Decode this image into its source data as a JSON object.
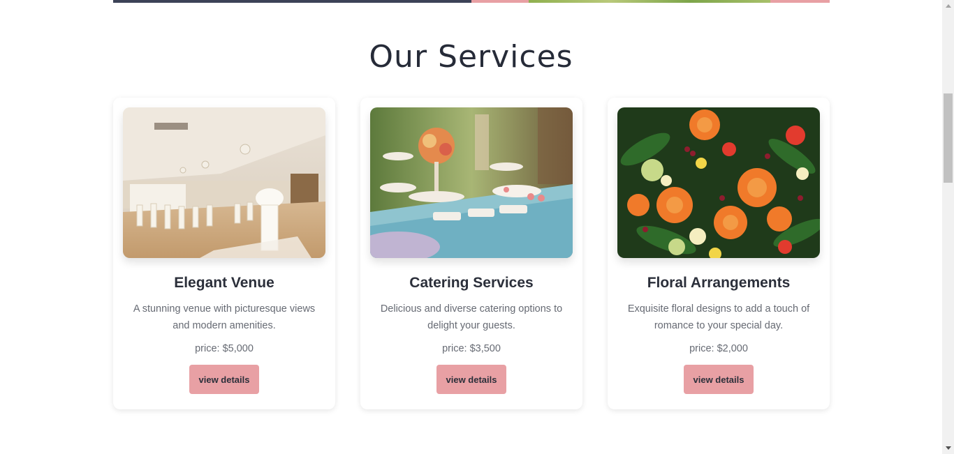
{
  "services": {
    "title": "Our Services",
    "cards": [
      {
        "image": "wedding-venue-hall-photo",
        "title": "Elegant Venue",
        "description": "A stunning venue with picturesque views and modern amenities.",
        "price": "price: $5,000",
        "button": "view details"
      },
      {
        "image": "catering-buffet-table-photo",
        "title": "Catering Services",
        "description": "Delicious and diverse catering options to delight your guests.",
        "price": "price: $3,500",
        "button": "view details"
      },
      {
        "image": "flower-bouquet-photo",
        "title": "Floral Arrangements",
        "description": "Exquisite floral designs to add a touch of romance to your special day.",
        "price": "price: $2,000",
        "button": "view details"
      }
    ]
  },
  "colors": {
    "accent": "#e8a0a4",
    "heading": "#262b38",
    "body_text": "#666a73",
    "top_strip_dark": "#3c4257"
  }
}
